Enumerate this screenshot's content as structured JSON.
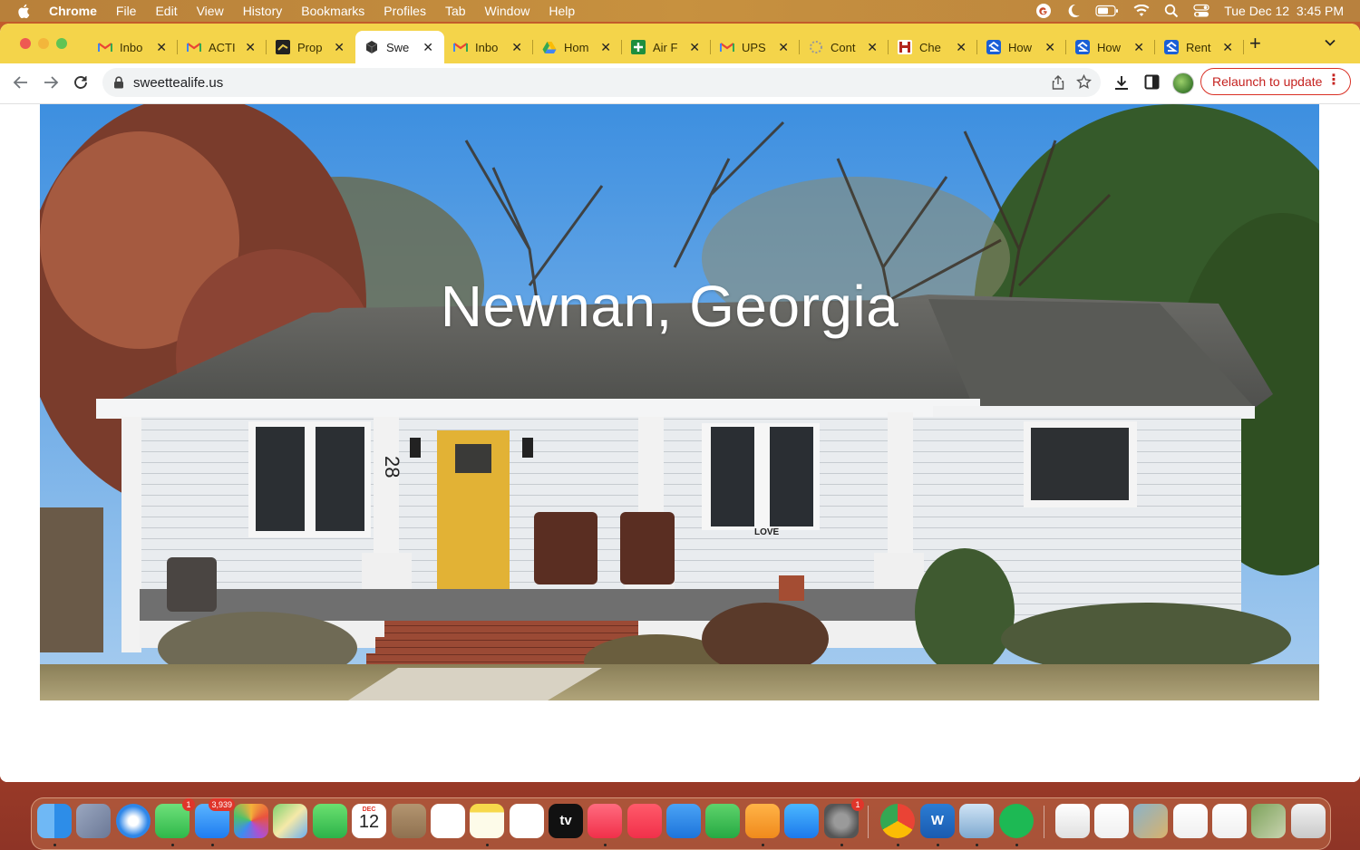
{
  "menubar": {
    "app_name": "Chrome",
    "items": [
      "File",
      "Edit",
      "View",
      "History",
      "Bookmarks",
      "Profiles",
      "Tab",
      "Window",
      "Help"
    ],
    "clock": "Tue Dec 12  3:45 PM"
  },
  "browser": {
    "tabs": [
      {
        "title": "Inbo",
        "icon": "gmail-icon"
      },
      {
        "title": "ACTI",
        "icon": "gmail-icon"
      },
      {
        "title": "Prop",
        "icon": "zillow-icon"
      },
      {
        "title": "Swe",
        "icon": "site-cube-icon",
        "active": true
      },
      {
        "title": "Inbo",
        "icon": "gmail-icon"
      },
      {
        "title": "Hom",
        "icon": "google-drive-icon"
      },
      {
        "title": "Air F",
        "icon": "sheets-plus-icon"
      },
      {
        "title": "UPS",
        "icon": "gmail-icon"
      },
      {
        "title": "Cont",
        "icon": "loading-icon"
      },
      {
        "title": "Che",
        "icon": "site-red-icon"
      },
      {
        "title": "How",
        "icon": "zillow-blue-icon"
      },
      {
        "title": "How",
        "icon": "zillow-blue-icon"
      },
      {
        "title": "Rent",
        "icon": "zillow-blue-icon"
      }
    ],
    "address": "sweettealife.us",
    "relaunch_label": "Relaunch to update"
  },
  "page": {
    "hero_title": "Newnan, Georgia",
    "house_number": "28",
    "porch_sign": "LOVE"
  },
  "dock": {
    "apps": [
      {
        "name": "finder"
      },
      {
        "name": "launchpad"
      },
      {
        "name": "safari"
      },
      {
        "name": "messages",
        "badge": "1"
      },
      {
        "name": "mail",
        "badge": "3,939"
      },
      {
        "name": "photos"
      },
      {
        "name": "maps"
      },
      {
        "name": "facetime"
      },
      {
        "name": "calendar",
        "month": "DEC",
        "day": "12"
      },
      {
        "name": "contacts"
      },
      {
        "name": "reminders"
      },
      {
        "name": "notes"
      },
      {
        "name": "freeform"
      },
      {
        "name": "apple-tv",
        "label": "tv"
      },
      {
        "name": "music"
      },
      {
        "name": "news"
      },
      {
        "name": "keynote"
      },
      {
        "name": "numbers"
      },
      {
        "name": "pages"
      },
      {
        "name": "app-store"
      },
      {
        "name": "system-settings",
        "badge": "1"
      },
      {
        "name": "chrome"
      },
      {
        "name": "word",
        "label": "W"
      },
      {
        "name": "preview"
      },
      {
        "name": "spotify"
      },
      {
        "name": "recent-window"
      },
      {
        "name": "recent-document"
      },
      {
        "name": "recent-image"
      },
      {
        "name": "recent-document"
      },
      {
        "name": "recent-document"
      },
      {
        "name": "recent-photo"
      },
      {
        "name": "trash"
      }
    ]
  },
  "colors": {
    "tabstrip": "#f4d44a",
    "relaunch": "#d93025",
    "sky": "#5aa6e8",
    "door": "#d8a824"
  }
}
